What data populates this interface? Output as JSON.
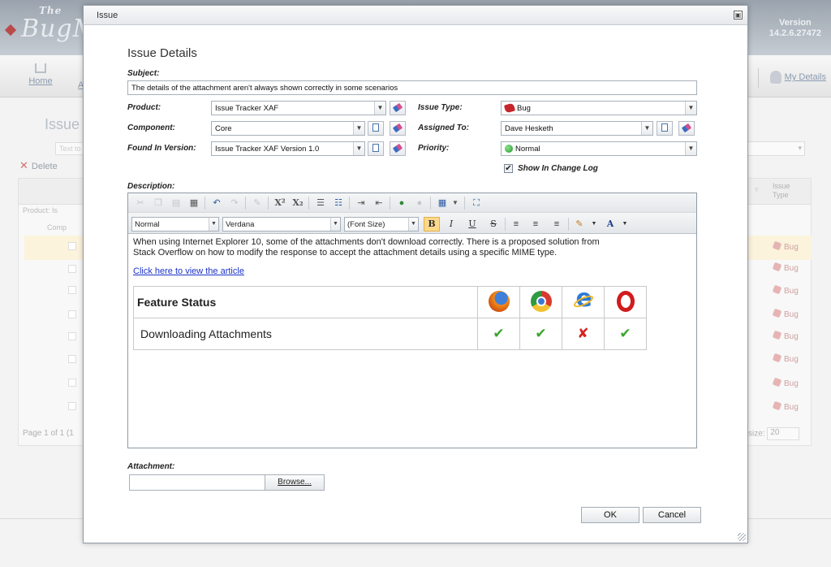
{
  "background": {
    "logo_prefix": "The",
    "logo_text": "BugMe",
    "version_label": "Version",
    "version_number": "14.2.6.27472",
    "nav_home": "Home",
    "nav_partial": "A",
    "nav_my_details": "My Details",
    "page_title": "Issue",
    "search_placeholder": "Text to",
    "delete_label": "Delete",
    "group_product": "Product: Is",
    "group_component": "Comp",
    "col_issue_type": "Issue Type",
    "row_type": "Bug",
    "pager_text": "Page 1 of 1 (1",
    "page_size_label": "size:",
    "page_size_value": "20"
  },
  "dialog": {
    "title": "Issue",
    "heading": "Issue Details",
    "subject_label": "Subject:",
    "subject_value": "The details of the attachment aren't always shown correctly in some scenarios",
    "product_label": "Product:",
    "product_value": "Issue Tracker XAF",
    "component_label": "Component:",
    "component_value": "Core",
    "found_in_version_label": "Found In Version:",
    "found_in_version_value": "Issue Tracker XAF Version 1.0",
    "issue_type_label": "Issue Type:",
    "issue_type_value": "Bug",
    "assigned_to_label": "Assigned To:",
    "assigned_to_value": "Dave Hesketh",
    "priority_label": "Priority:",
    "priority_value": "Normal",
    "show_in_change_log_label": "Show In Change Log",
    "show_in_change_log_checked": "✔",
    "description_label": "Description:",
    "attachment_label": "Attachment:",
    "browse_label": "Browse...",
    "ok_label": "OK",
    "cancel_label": "Cancel"
  },
  "editor": {
    "paragraph_style": "Normal",
    "font_name": "Verdana",
    "font_size": "(Font Size)",
    "bold": "B",
    "italic": "I",
    "underline": "U",
    "strike": "S",
    "superscript": "X²",
    "subscript": "X₂",
    "font_color_glyph": "A",
    "body_text": "When using Internet Explorer 10, some of the attachments don't download correctly. There is a proposed solution from Stack Overflow on how to modify the response to accept the attachment details using a specific MIME type.",
    "link_text": "Click here to view the article",
    "table": {
      "header": "Feature Status",
      "row_label": "Downloading Attachments",
      "browsers": [
        "firefox-icon",
        "chrome-icon",
        "internet-explorer-icon",
        "opera-icon"
      ],
      "status_marks": [
        "✔",
        "✔",
        "✘",
        "✔"
      ]
    }
  },
  "colors": {
    "accent_active_button": "#ffd98a",
    "link": "#1a33c9",
    "ok_tick": "#3aa52c",
    "fail_cross": "#d62222"
  }
}
